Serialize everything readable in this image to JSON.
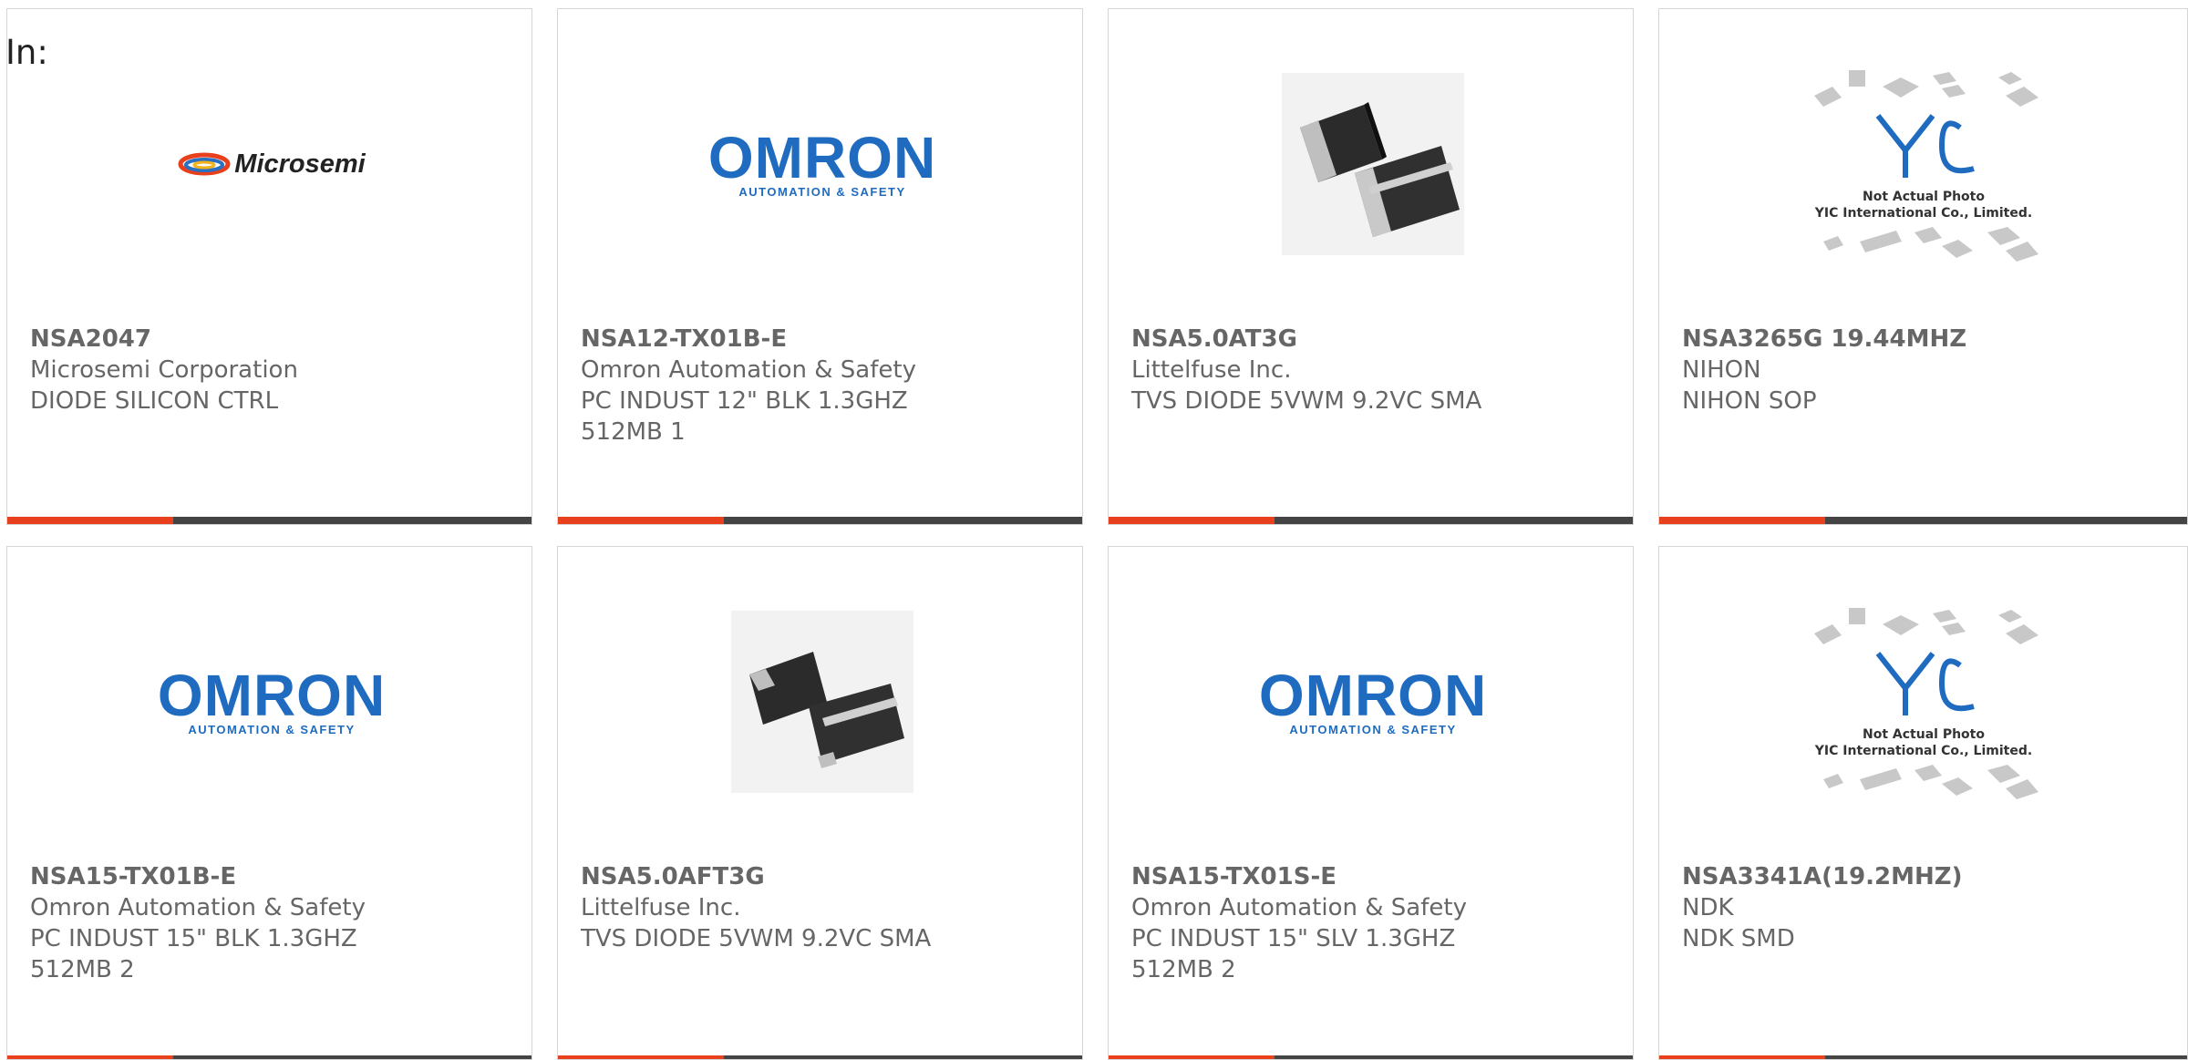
{
  "prefix": "In:",
  "colors": {
    "accent": "#e8401c",
    "bar": "#444444",
    "text": "#666666",
    "omron_blue": "#1f6bc0"
  },
  "cards": [
    {
      "part_number": "NSA2047",
      "manufacturer": "Microsemi Corporation",
      "description": "DIODE SILICON CTRL",
      "image": "microsemi-logo",
      "logo_text": "Microsemi"
    },
    {
      "part_number": "NSA12-TX01B-E",
      "manufacturer": "Omron Automation & Safety",
      "description": "PC INDUST 12\" BLK 1.3GHZ 512MB 1",
      "image": "omron-logo",
      "logo_text": "OMRON",
      "logo_sub": "AUTOMATION & SAFETY"
    },
    {
      "part_number": "NSA5.0AT3G",
      "manufacturer": "Littelfuse Inc.",
      "description": "TVS DIODE 5VWM 9.2VC SMA",
      "image": "diode-photo"
    },
    {
      "part_number": "NSA3265G 19.44MHZ",
      "manufacturer": "NIHON",
      "description": "NIHON SOP",
      "image": "yic-placeholder",
      "logo_text": "YIC",
      "note_1": "Not Actual Photo",
      "note_2": "YIC International Co., Limited."
    },
    {
      "part_number": "NSA15-TX01B-E",
      "manufacturer": "Omron Automation & Safety",
      "description": "PC INDUST 15\" BLK 1.3GHZ 512MB 2",
      "image": "omron-logo",
      "logo_text": "OMRON",
      "logo_sub": "AUTOMATION & SAFETY"
    },
    {
      "part_number": "NSA5.0AFT3G",
      "manufacturer": "Littelfuse Inc.",
      "description": "TVS DIODE 5VWM 9.2VC SMA",
      "image": "diode-photo"
    },
    {
      "part_number": "NSA15-TX01S-E",
      "manufacturer": "Omron Automation & Safety",
      "description": "PC INDUST 15\" SLV 1.3GHZ 512MB 2",
      "image": "omron-logo",
      "logo_text": "OMRON",
      "logo_sub": "AUTOMATION & SAFETY"
    },
    {
      "part_number": "NSA3341A(19.2MHZ)",
      "manufacturer": "NDK",
      "description": "NDK SMD",
      "image": "yic-placeholder",
      "logo_text": "YIC",
      "note_1": "Not Actual Photo",
      "note_2": "YIC International Co., Limited."
    }
  ]
}
